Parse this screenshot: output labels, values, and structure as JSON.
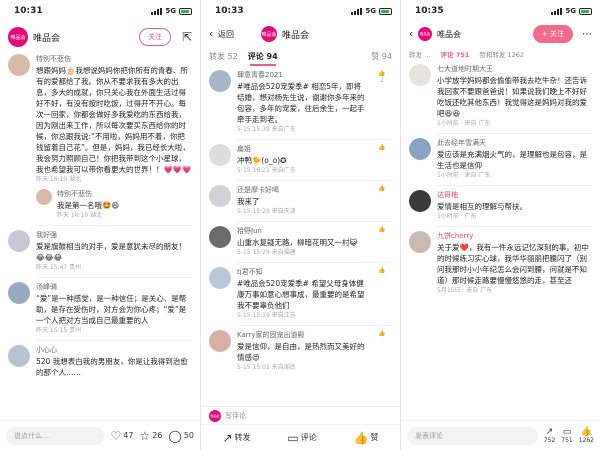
{
  "colors": {
    "brand": "#e60a78",
    "accent": "#e85d8f",
    "heart": "#e0457b"
  },
  "panel1": {
    "status": {
      "time": "10:31",
      "network": "5G"
    },
    "bar": {
      "logo": "唯品会",
      "name": "唯品会",
      "follow": "关注",
      "share_icon": "share-icon"
    },
    "posts": [
      {
        "user": "特别不悲伤",
        "text": "想跟妈妈🎂我想说妈妈你把你所有的青春、所有的爱都给了我。你从不要求我有多大的出息，多大的成就，你只关心我在外面生活过得好不好，有没有按时吃饭，过得开不开心。每次一回家，你都会做好多我爱吃的东西给我，因为刚出来工作，所以每次要买东西给你的时候，你总跟我说:“不用啦，妈妈用不着，你把钱留着自己花”。但是，妈妈，我已经长大啦，我会努力照顾自己！你把我带到这个小星球，我也希望我可以带你看更大的世界！！💗💗💗",
        "meta": "昨天 16:10 湖北"
      },
      {
        "user": "特别不悲伤",
        "text": "我是第一名哦🤩😄",
        "meta": "昨天 16:10 湖北",
        "reply": true
      },
      {
        "user": "我好强",
        "text": "爱是旗鼓相当的对手，爱是意犹未尽的朋友！😂😂😂",
        "meta": "昨天 15:47 贵州"
      },
      {
        "user": "汤峰骑",
        "text": "“爱”是一种感觉，是一种信任；是关心、是帮助，是存在受伤时，对方会为你心疼；“爱”是一个人把对方当成自己最重要的人",
        "meta": "昨天 15:15 贵州"
      },
      {
        "user": "小心心",
        "text": "520 我想表白我的男朋友，你是让我得到治愈的那个人……",
        "meta": ""
      }
    ],
    "bottom": {
      "placeholder": "说点什么…",
      "likes": "47",
      "stars": "26",
      "comments": "50"
    }
  },
  "panel2": {
    "status": {
      "time": "10:33",
      "network": "5G"
    },
    "bar": {
      "back": "返回",
      "logo": "唯品会",
      "name": "唯品会"
    },
    "tabs": {
      "forward": "转发 52",
      "comment": "评论 94",
      "like": "赞 94"
    },
    "posts": [
      {
        "user": "肆意青春2021",
        "text": "#唯品会520宠爱季# 相恋5年，即将结婚，想对杨先生说，谢谢你多年来的包容，多年的宠爱，往后余生，一起手牵手走到老。",
        "meta": "5-15 15:39 来自广东",
        "likes": "2"
      },
      {
        "user": "扁姐",
        "text": "冲鸭🐤(o_o)✪",
        "meta": "5-15 16:21 来自广东",
        "likes": ""
      },
      {
        "user": "还是摩卡好喝",
        "text": "我来了",
        "meta": "5-15 15:29 来自天津",
        "likes": ""
      },
      {
        "user": "拾野Jun",
        "text": "山重水复疑无路，柳暗花明又一村😺",
        "meta": "5-15 15:29 来自福建",
        "likes": ""
      },
      {
        "user": "tj君不知",
        "text": "#唯品会520宠爱季# 希望父母身体健康万事如意心想事成，最重要的是希望我不要辜负他们",
        "meta": "5-15 15:19 来自江苏",
        "likes": ""
      },
      {
        "user": "Karry家的固宠出道殿",
        "text": "爱是信仰，是自由，是热烈而又美好的情感😍",
        "meta": "5-15 15:01 来自湖南",
        "likes": ""
      }
    ],
    "bottom": {
      "write": "写评论",
      "forward": "转发",
      "comment": "评论",
      "like": "赞"
    }
  },
  "panel3": {
    "status": {
      "time": "10:35",
      "network": "5G"
    },
    "bar": {
      "logo": "唯品会",
      "name": "唯品会",
      "follow": "+ 关注"
    },
    "tabs": {
      "forward": "转发 …",
      "comment": "评论 751",
      "like": "赞和转发 1262"
    },
    "posts": [
      {
        "user": "七大道地时期大王",
        "text": "小学放学妈妈都会偷偷带我去吃牛杂！还告诉我回家不要跟爸爸说！如果说我们晚上不好好吃饭还吃其他东西！我觉得这是妈妈对我的爱吧😆😆",
        "meta": "1小时前 · 来自 广东",
        "likes": ""
      },
      {
        "user": "此去经年雪满天",
        "text": "爱应该是充满烟火气的，是理解也是包容，是生活也是信仰",
        "meta": "1小时前 · 来自 广东",
        "likes": ""
      },
      {
        "user": "达哥柚",
        "text": "爱情是相互的理解与帮扶。",
        "meta": "1小时前 · 广东",
        "likes": ""
      },
      {
        "user": "九饼cherry",
        "text": "关于爱❤️，我有一件永远记忆深刻的事。初中的时候练习实心球，我华华丽丽把腰闪了（别问我那时小小年纪怎么会闪到腰，问就是不知道）那时候走路要慢慢悠悠的走，甚至还",
        "meta": "5月15日 · 来自 广东",
        "likes": ""
      }
    ],
    "bottom": {
      "placeholder": "发表评论",
      "forward": "752",
      "comment": "751",
      "like": "1262"
    }
  }
}
